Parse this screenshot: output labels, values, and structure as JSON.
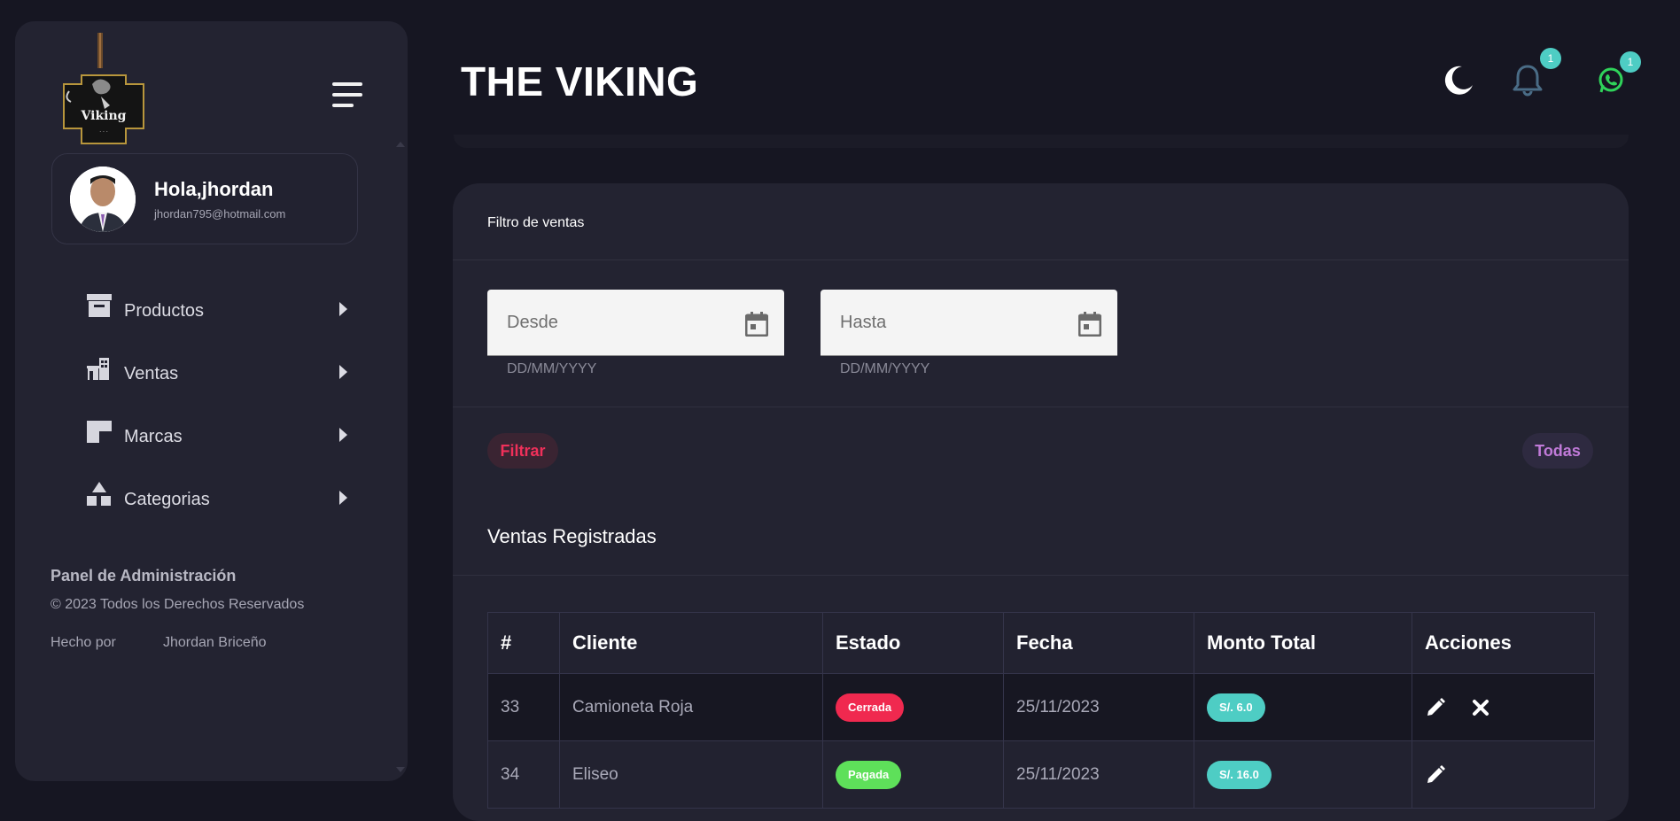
{
  "header": {
    "title": "THE VIKING",
    "notification_count": "1",
    "whatsapp_count": "1"
  },
  "sidebar": {
    "logo_text": "Viking",
    "user": {
      "greeting": "Hola,jhordan",
      "email": "jhordan795@hotmail.com"
    },
    "items": [
      {
        "label": "Productos",
        "icon": "archive-icon"
      },
      {
        "label": "Ventas",
        "icon": "store-icon"
      },
      {
        "label": "Marcas",
        "icon": "tag-icon"
      },
      {
        "label": "Categorias",
        "icon": "shapes-icon"
      }
    ],
    "footer": {
      "title": "Panel de Administración",
      "copyright": "© 2023 Todos los Derechos Reservados",
      "made_by_label": "Hecho por",
      "author": "Jhordan Briceño"
    }
  },
  "filter": {
    "title": "Filtro de ventas",
    "from_label": "Desde",
    "to_label": "Hasta",
    "from_hint": "DD/MM/YYYY",
    "to_hint": "DD/MM/YYYY",
    "filter_button": "Filtrar",
    "all_button": "Todas"
  },
  "sales": {
    "title": "Ventas Registradas",
    "columns": [
      "#",
      "Cliente",
      "Estado",
      "Fecha",
      "Monto Total",
      "Acciones"
    ],
    "rows": [
      {
        "id": "33",
        "client": "Camioneta Roja",
        "status": "Cerrada",
        "date": "25/11/2023",
        "total": "S/. 6.0"
      },
      {
        "id": "34",
        "client": "Eliseo",
        "status": "Pagada",
        "date": "25/11/2023",
        "total": "S/. 16.0"
      }
    ]
  },
  "colors": {
    "background": "#161622",
    "panel": "#232331",
    "status_cerrada": "#f0294f",
    "status_pagada": "#5ee05a",
    "total_badge": "#4ecdc4",
    "filter_text": "#f0305a",
    "all_text": "#c07ad8"
  }
}
